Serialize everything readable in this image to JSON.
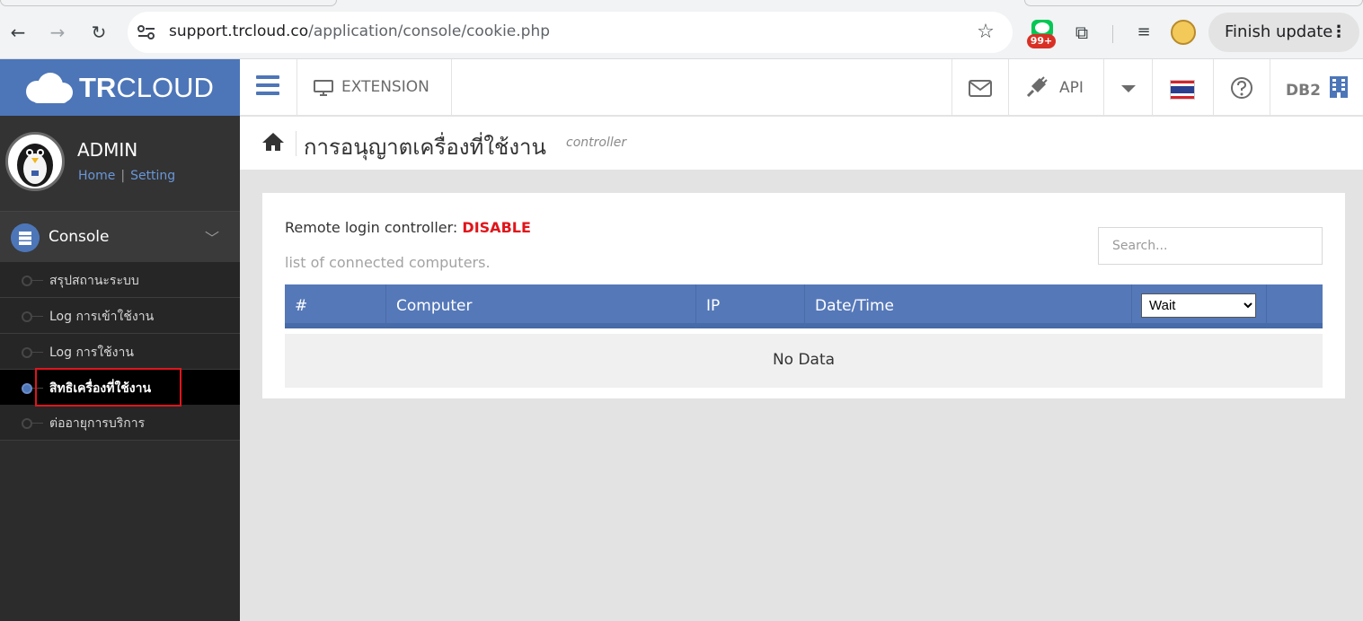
{
  "browser": {
    "url_host": "support.trcloud.co",
    "url_path": "/application/console/cookie.php",
    "ext_badge": "99+",
    "update_label": "Finish update",
    "kebab": "⋮"
  },
  "logo": {
    "bold": "TR",
    "rest": "CLOUD"
  },
  "user": {
    "name": "ADMIN",
    "home_link": "Home",
    "separator": "|",
    "setting_link": "Setting"
  },
  "sidebar": {
    "section": "Console",
    "items": [
      {
        "label": "สรุปสถานะระบบ",
        "active": false
      },
      {
        "label": "Log การเข้าใช้งาน",
        "active": false
      },
      {
        "label": "Log การใช้งาน",
        "active": false
      },
      {
        "label": "สิทธิเครื่องที่ใช้งาน",
        "active": true
      },
      {
        "label": "ต่ออายุการบริการ",
        "active": false
      }
    ]
  },
  "topbar": {
    "extension_label": "EXTENSION",
    "api_label": "API",
    "db_label": "DB2"
  },
  "page": {
    "title": "การอนุญาตเครื่องที่ใช้งาน",
    "subtitle": "controller"
  },
  "content": {
    "remote_label": "Remote login controller:",
    "remote_status": "DISABLE",
    "list_caption": "list of connected computers.",
    "search_placeholder": "Search...",
    "columns": [
      "#",
      "Computer",
      "IP",
      "Date/Time"
    ],
    "status_filter": "Wait",
    "empty_text": "No Data"
  },
  "colors": {
    "brand_blue": "#4d76b8",
    "table_header": "#5578b8",
    "status_red": "#e0151b",
    "sidebar_bg": "#2c2c2c"
  }
}
